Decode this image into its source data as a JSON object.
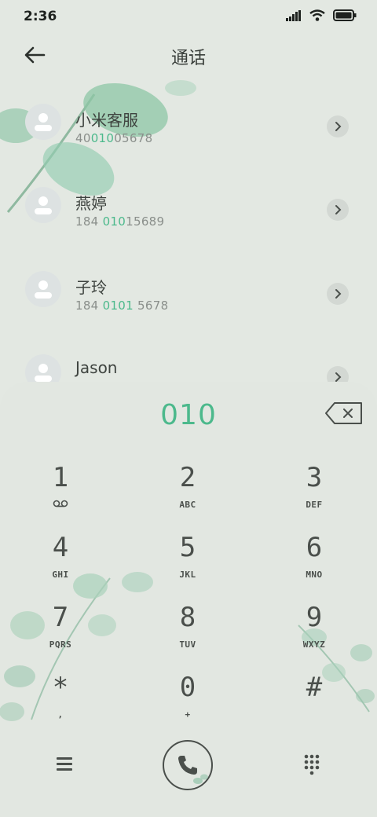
{
  "status_bar": {
    "time": "2:36",
    "icons": [
      "signal-icon",
      "wifi-icon",
      "battery-icon"
    ]
  },
  "header": {
    "title": "通话",
    "back_icon": "arrow-left-icon"
  },
  "contacts": [
    {
      "name": "小米客服",
      "number_parts": [
        "40",
        "010",
        "05678"
      ]
    },
    {
      "name": "燕婷",
      "number_parts": [
        "184 ",
        "010",
        "15689"
      ]
    },
    {
      "name": "子玲",
      "number_parts": [
        "184 ",
        "0101",
        " 5678"
      ]
    },
    {
      "name": "Jason",
      "number_parts": [
        "",
        "",
        ""
      ]
    }
  ],
  "dialpad": {
    "input": "010",
    "delete_icon": "backspace-icon",
    "keys": [
      {
        "digit": "1",
        "letters": ""
      },
      {
        "digit": "2",
        "letters": "ABC"
      },
      {
        "digit": "3",
        "letters": "DEF"
      },
      {
        "digit": "4",
        "letters": "GHI"
      },
      {
        "digit": "5",
        "letters": "JKL"
      },
      {
        "digit": "6",
        "letters": "MNO"
      },
      {
        "digit": "7",
        "letters": "PQRS"
      },
      {
        "digit": "8",
        "letters": "TUV"
      },
      {
        "digit": "9",
        "letters": "WXYZ"
      },
      {
        "digit": "*",
        "letters": ","
      },
      {
        "digit": "0",
        "letters": "+"
      },
      {
        "digit": "#",
        "letters": ""
      }
    ],
    "bottom": {
      "menu_icon": "menu-icon",
      "call_icon": "phone-icon",
      "keypad_icon": "keypad-icon"
    }
  },
  "colors": {
    "accent": "#4cb98c",
    "background": "#e3e8e2",
    "text": "#4a4f4b"
  }
}
